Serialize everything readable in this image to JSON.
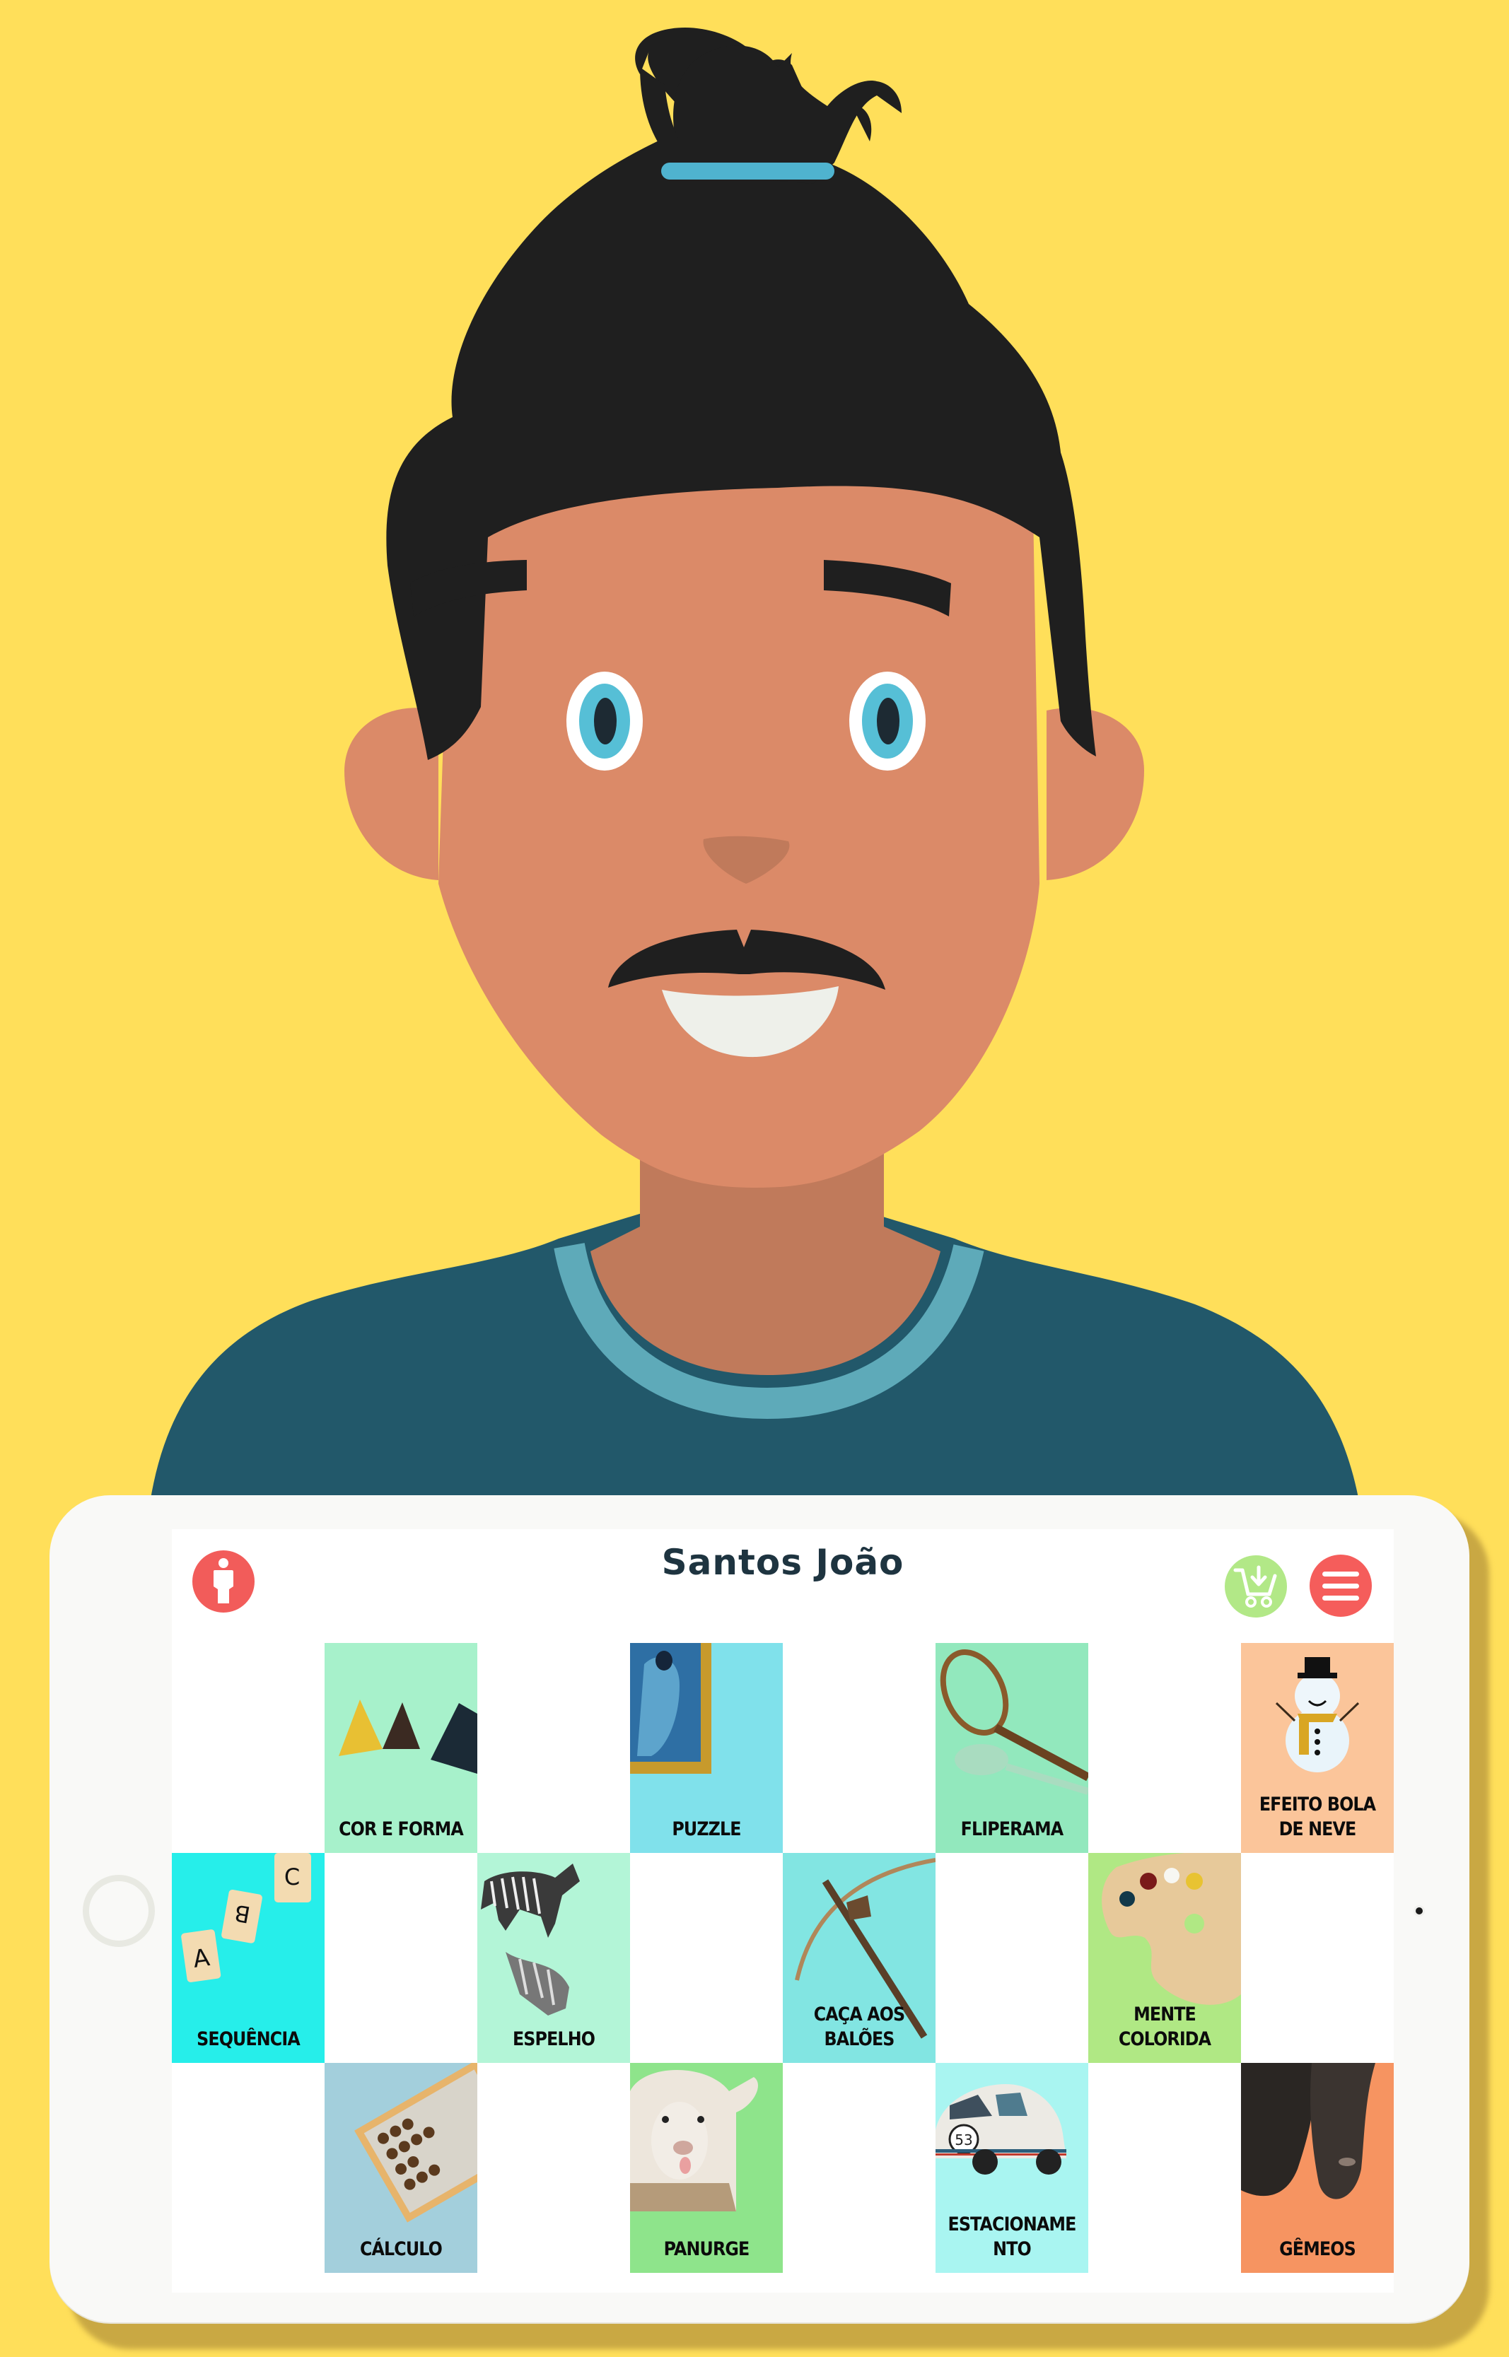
{
  "colors": {
    "background": "#ffdf5a",
    "skin": "#db8a68",
    "skin_shadow": "#c07a5b",
    "hair": "#1f1f1f",
    "hair_tie": "#4fb3cf",
    "eye_iris": "#56bfd6",
    "shirt": "#22586a",
    "shirt_collar": "#5eaab9",
    "title_text": "#1e3440",
    "profile_button": "#f25c5a",
    "cart_button": "#b2e887",
    "menu_button": "#f55d5b"
  },
  "header": {
    "title": "Santos João",
    "profile_icon": "person-icon",
    "cart_icon": "cart-download-icon",
    "menu_icon": "hamburger-menu-icon"
  },
  "grid": {
    "rows": 3,
    "columns": 8,
    "tiles": [
      {
        "row": 1,
        "col": 2,
        "label": "COR E FORMA",
        "color": "#a7f1cb",
        "icon": "pyramids-icon"
      },
      {
        "row": 1,
        "col": 4,
        "label": "PUZZLE",
        "color": "#80e1eb",
        "icon": "framed-painting-icon"
      },
      {
        "row": 1,
        "col": 6,
        "label": "FLIPERAMA",
        "color": "#92e8bd",
        "icon": "tennis-racket-icon"
      },
      {
        "row": 1,
        "col": 8,
        "label": "EFEITO BOLA\nDE NEVE",
        "color": "#fbc59a",
        "icon": "snowman-icon"
      },
      {
        "row": 2,
        "col": 1,
        "label": "SEQUÊNCIA",
        "color": "#26eeea",
        "icon": "abc-tiles-icon"
      },
      {
        "row": 2,
        "col": 3,
        "label": "ESPELHO",
        "color": "#b3f5d7",
        "icon": "zebra-reflection-icon"
      },
      {
        "row": 2,
        "col": 5,
        "label": "CAÇA AOS\nBALÕES",
        "color": "#82e5e2",
        "icon": "crossbow-icon"
      },
      {
        "row": 2,
        "col": 7,
        "label": "MENTE\nCOLORIDA",
        "color": "#b0e884",
        "icon": "paint-palette-icon"
      },
      {
        "row": 3,
        "col": 2,
        "label": "CÁLCULO",
        "color": "#a3cfdc",
        "icon": "abacus-icon"
      },
      {
        "row": 3,
        "col": 4,
        "label": "PANURGE",
        "color": "#8ee48b",
        "icon": "sheep-icon"
      },
      {
        "row": 3,
        "col": 6,
        "label": "ESTACIONAME\nNTO",
        "color": "#a9f5f1",
        "icon": "beetle-car-icon"
      },
      {
        "row": 3,
        "col": 8,
        "label": "GÊMEOS",
        "color": "#f69461",
        "icon": "shoes-icon"
      }
    ]
  }
}
